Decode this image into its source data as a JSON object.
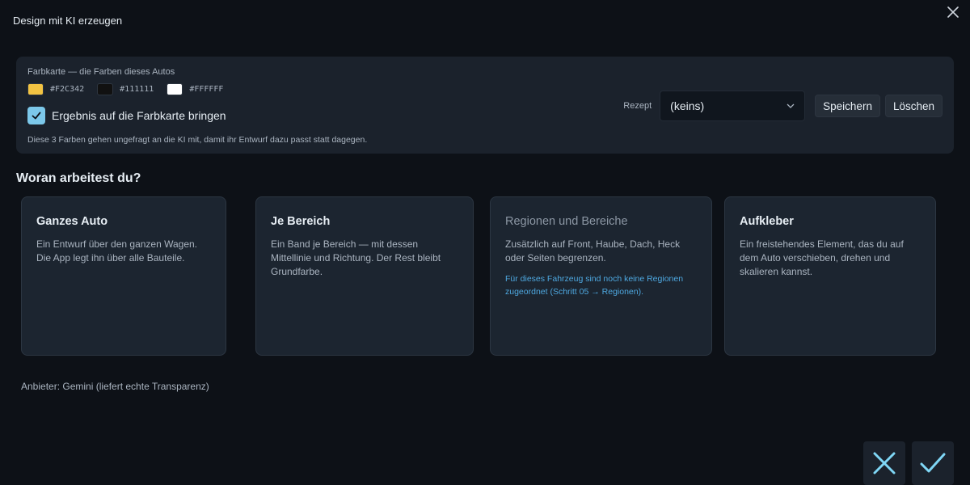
{
  "dialog": {
    "title": "Design mit KI erzeugen"
  },
  "palette": {
    "heading": "Farbkarte — die Farben dieses Autos",
    "swatches": [
      {
        "hex": "#F2C342"
      },
      {
        "hex": "#111111"
      },
      {
        "hex": "#FFFFFF"
      }
    ],
    "apply_checkbox": {
      "label": "Ergebnis auf die Farbkarte bringen",
      "checked": true
    },
    "hint": "Diese 3 Farben gehen ungefragt an die KI mit, damit ihr Entwurf dazu passt statt dagegen."
  },
  "recipe": {
    "label": "Rezept",
    "selected": "(keins)",
    "save_label": "Speichern",
    "delete_label": "Löschen"
  },
  "section": {
    "title": "Woran arbeitest du?"
  },
  "cards": [
    {
      "title": "Ganzes Auto",
      "description": "Ein Entwurf über den ganzen Wagen. Die App legt ihn über alle Bauteile.",
      "note": ""
    },
    {
      "title": "Je Bereich",
      "description": "Ein Band je Bereich — mit dessen Mittellinie und Richtung. Der Rest bleibt Grundfarbe.",
      "note": ""
    },
    {
      "title": "Regionen und Bereiche",
      "description": "Zusätzlich auf Front, Haube, Dach, Heck oder Seiten begrenzen.",
      "note": "Für dieses Fahrzeug sind noch keine Regionen zugeordnet (Schritt 05 → Regionen)."
    },
    {
      "title": "Aufkleber",
      "description": "Ein freistehendes Element, das du auf dem Auto verschieben, drehen und skalieren kannst.",
      "note": ""
    }
  ],
  "provider": "Anbieter: Gemini (liefert echte Transparenz)",
  "footer": {
    "cancel_icon": "close-icon",
    "confirm_icon": "check-icon"
  },
  "colors": {
    "background": "#0d1117",
    "panel": "#1b222c",
    "card": "#1c2530",
    "accent": "#7cc8ea",
    "link": "#4ea8e0"
  }
}
